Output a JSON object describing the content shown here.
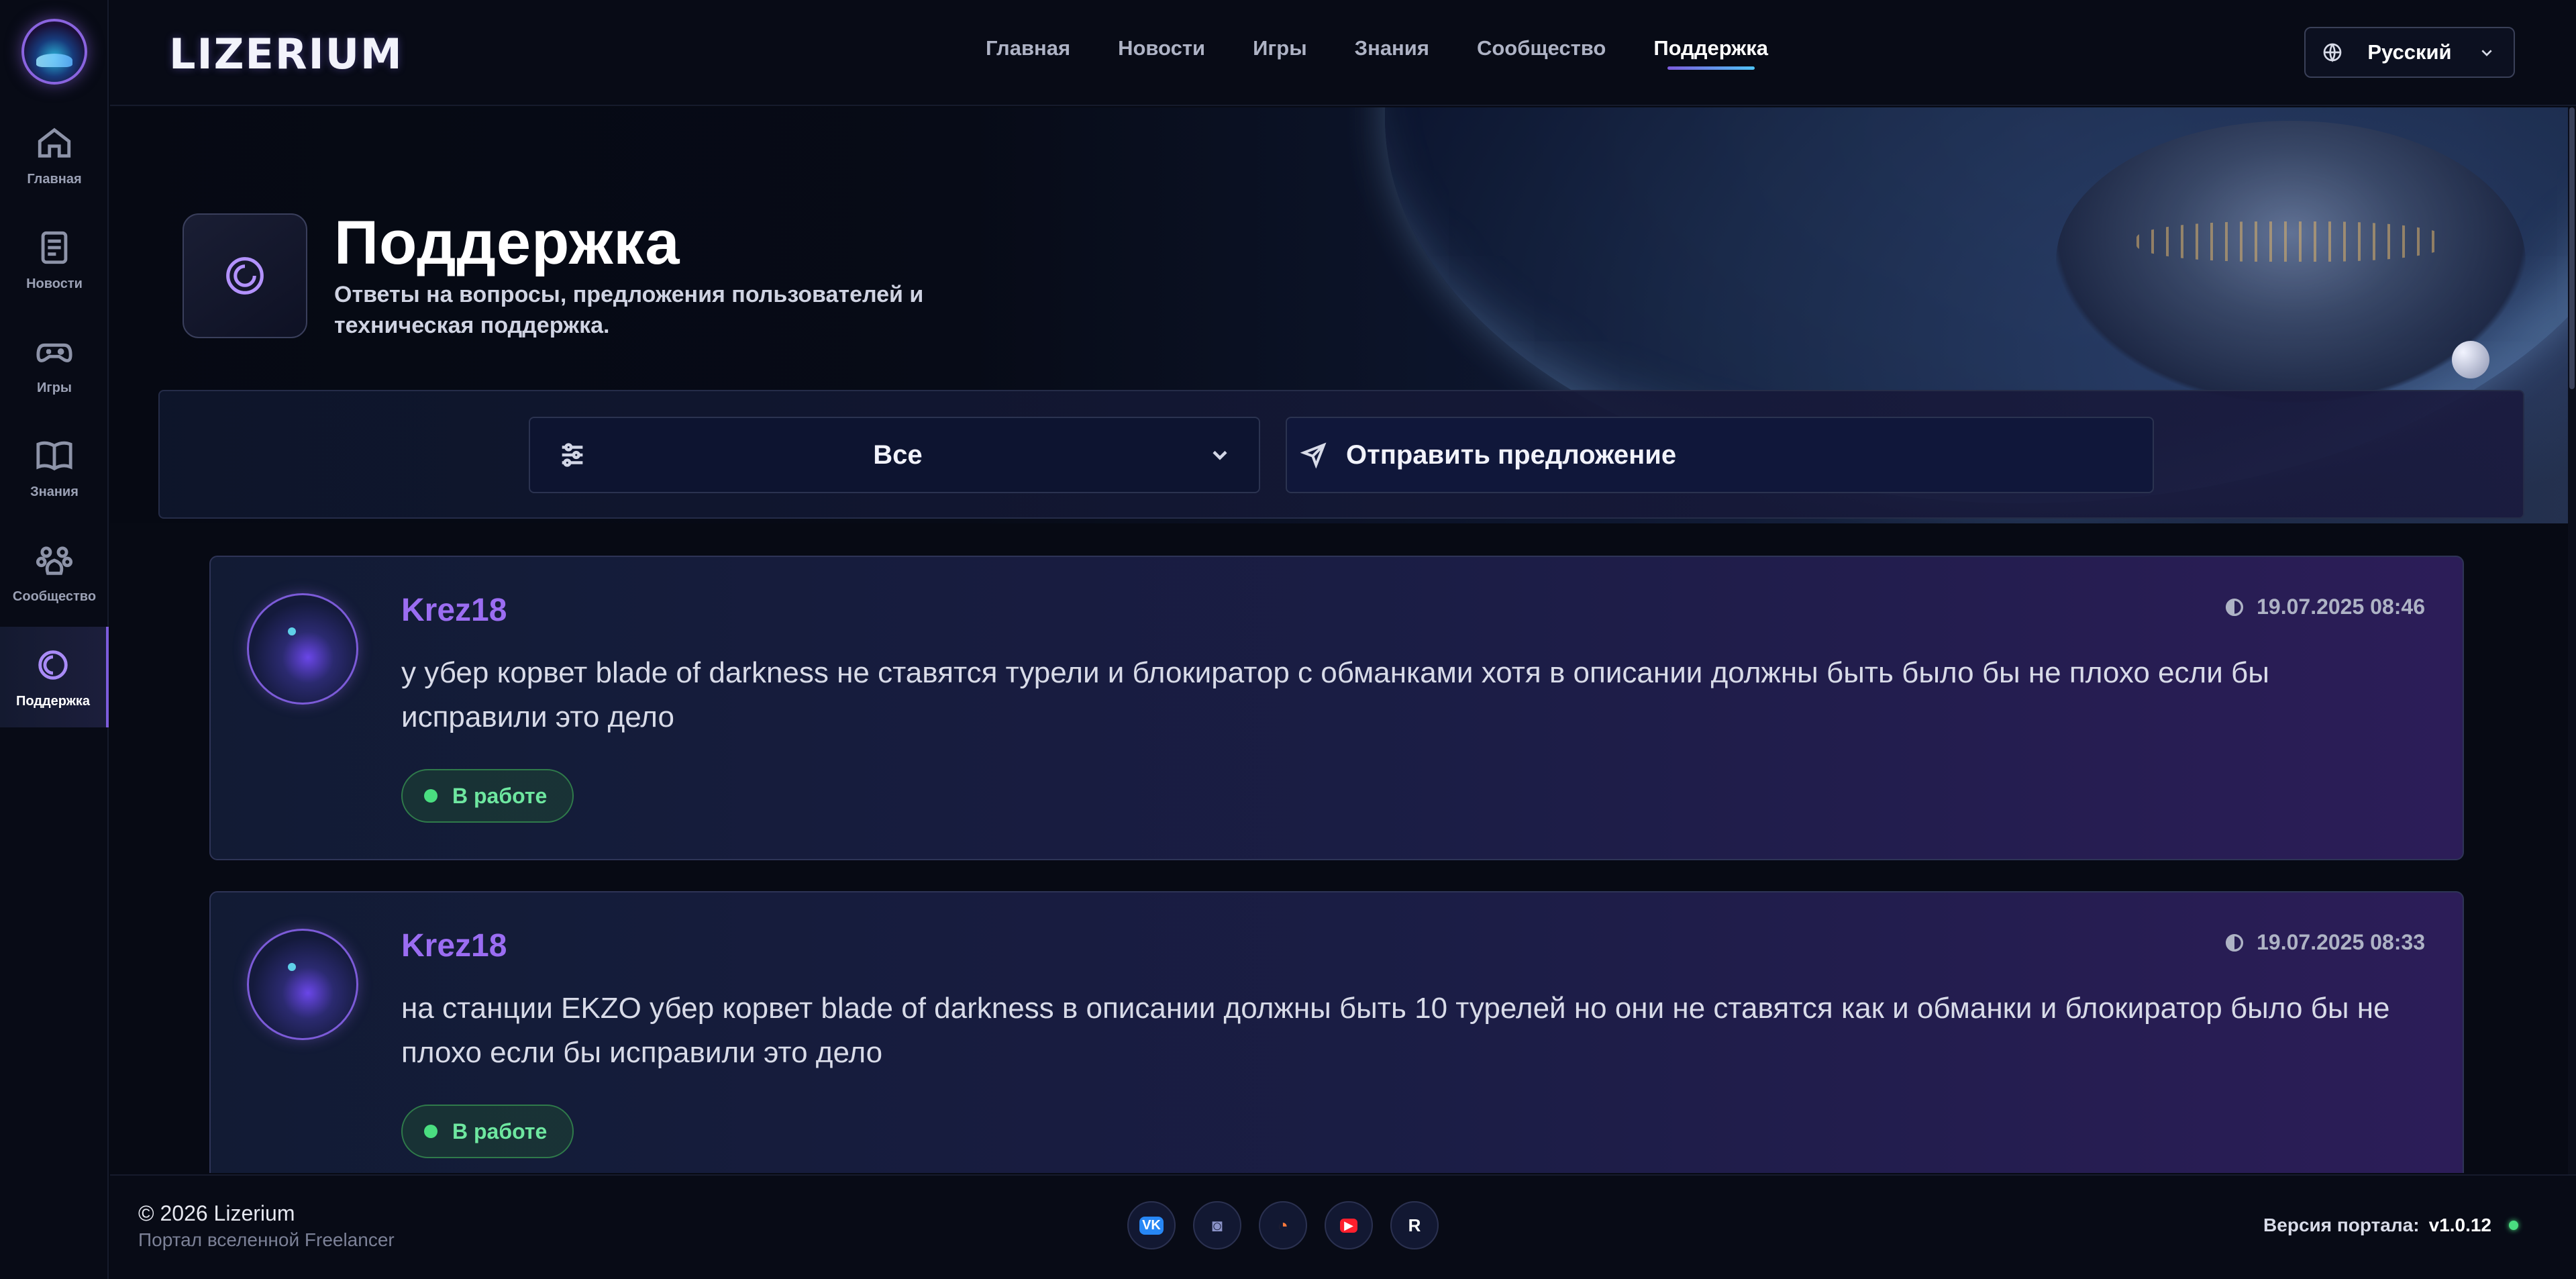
{
  "rail": {
    "items": [
      {
        "label": "Главная",
        "icon": "home-icon"
      },
      {
        "label": "Новости",
        "icon": "newspaper-icon"
      },
      {
        "label": "Игры",
        "icon": "gamepad-icon"
      },
      {
        "label": "Знания",
        "icon": "book-icon"
      },
      {
        "label": "Сообщество",
        "icon": "paw-icon"
      },
      {
        "label": "Поддержка",
        "icon": "support-icon",
        "active": true
      }
    ]
  },
  "header": {
    "brand": "LIZERIUM",
    "nav": [
      "Главная",
      "Новости",
      "Игры",
      "Знания",
      "Сообщество",
      "Поддержка"
    ],
    "active_nav": "Поддержка",
    "language": "Русский"
  },
  "hero": {
    "title": "Поддержка",
    "subtitle": "Ответы на вопросы, предложения пользователей и техническая поддержка."
  },
  "filter": {
    "selected": "Все",
    "suggest_label": "Отправить предложение"
  },
  "posts": [
    {
      "author": "Krez18",
      "date": "19.07.2025 08:46",
      "text": "у убер корвет blade of darkness не ставятся турели и блокиратор с обманками хотя в описании должны быть было бы не плохо если бы исправили это дело",
      "status": "В работе"
    },
    {
      "author": "Krez18",
      "date": "19.07.2025 08:33",
      "text": "на станции EKZO убер корвет blade of darkness в описании должны быть 10 турелей но они не ставятся как и обманки и блокиратор было бы не плохо если бы исправили это дело",
      "status": "В работе"
    }
  ],
  "footer": {
    "copyright": "© 2026 Lizerium",
    "tagline": "Портал вселенной Freelancer",
    "socials": [
      "vk-icon",
      "discord-icon",
      "gauge-icon",
      "youtube-icon",
      "rutube-icon"
    ],
    "version_label": "Версия портала:",
    "version": "v1.0.12"
  },
  "colors": {
    "accent": "#7d5cdc",
    "author": "#9b6df2",
    "status_green": "#4ade80",
    "background": "#070a14"
  }
}
